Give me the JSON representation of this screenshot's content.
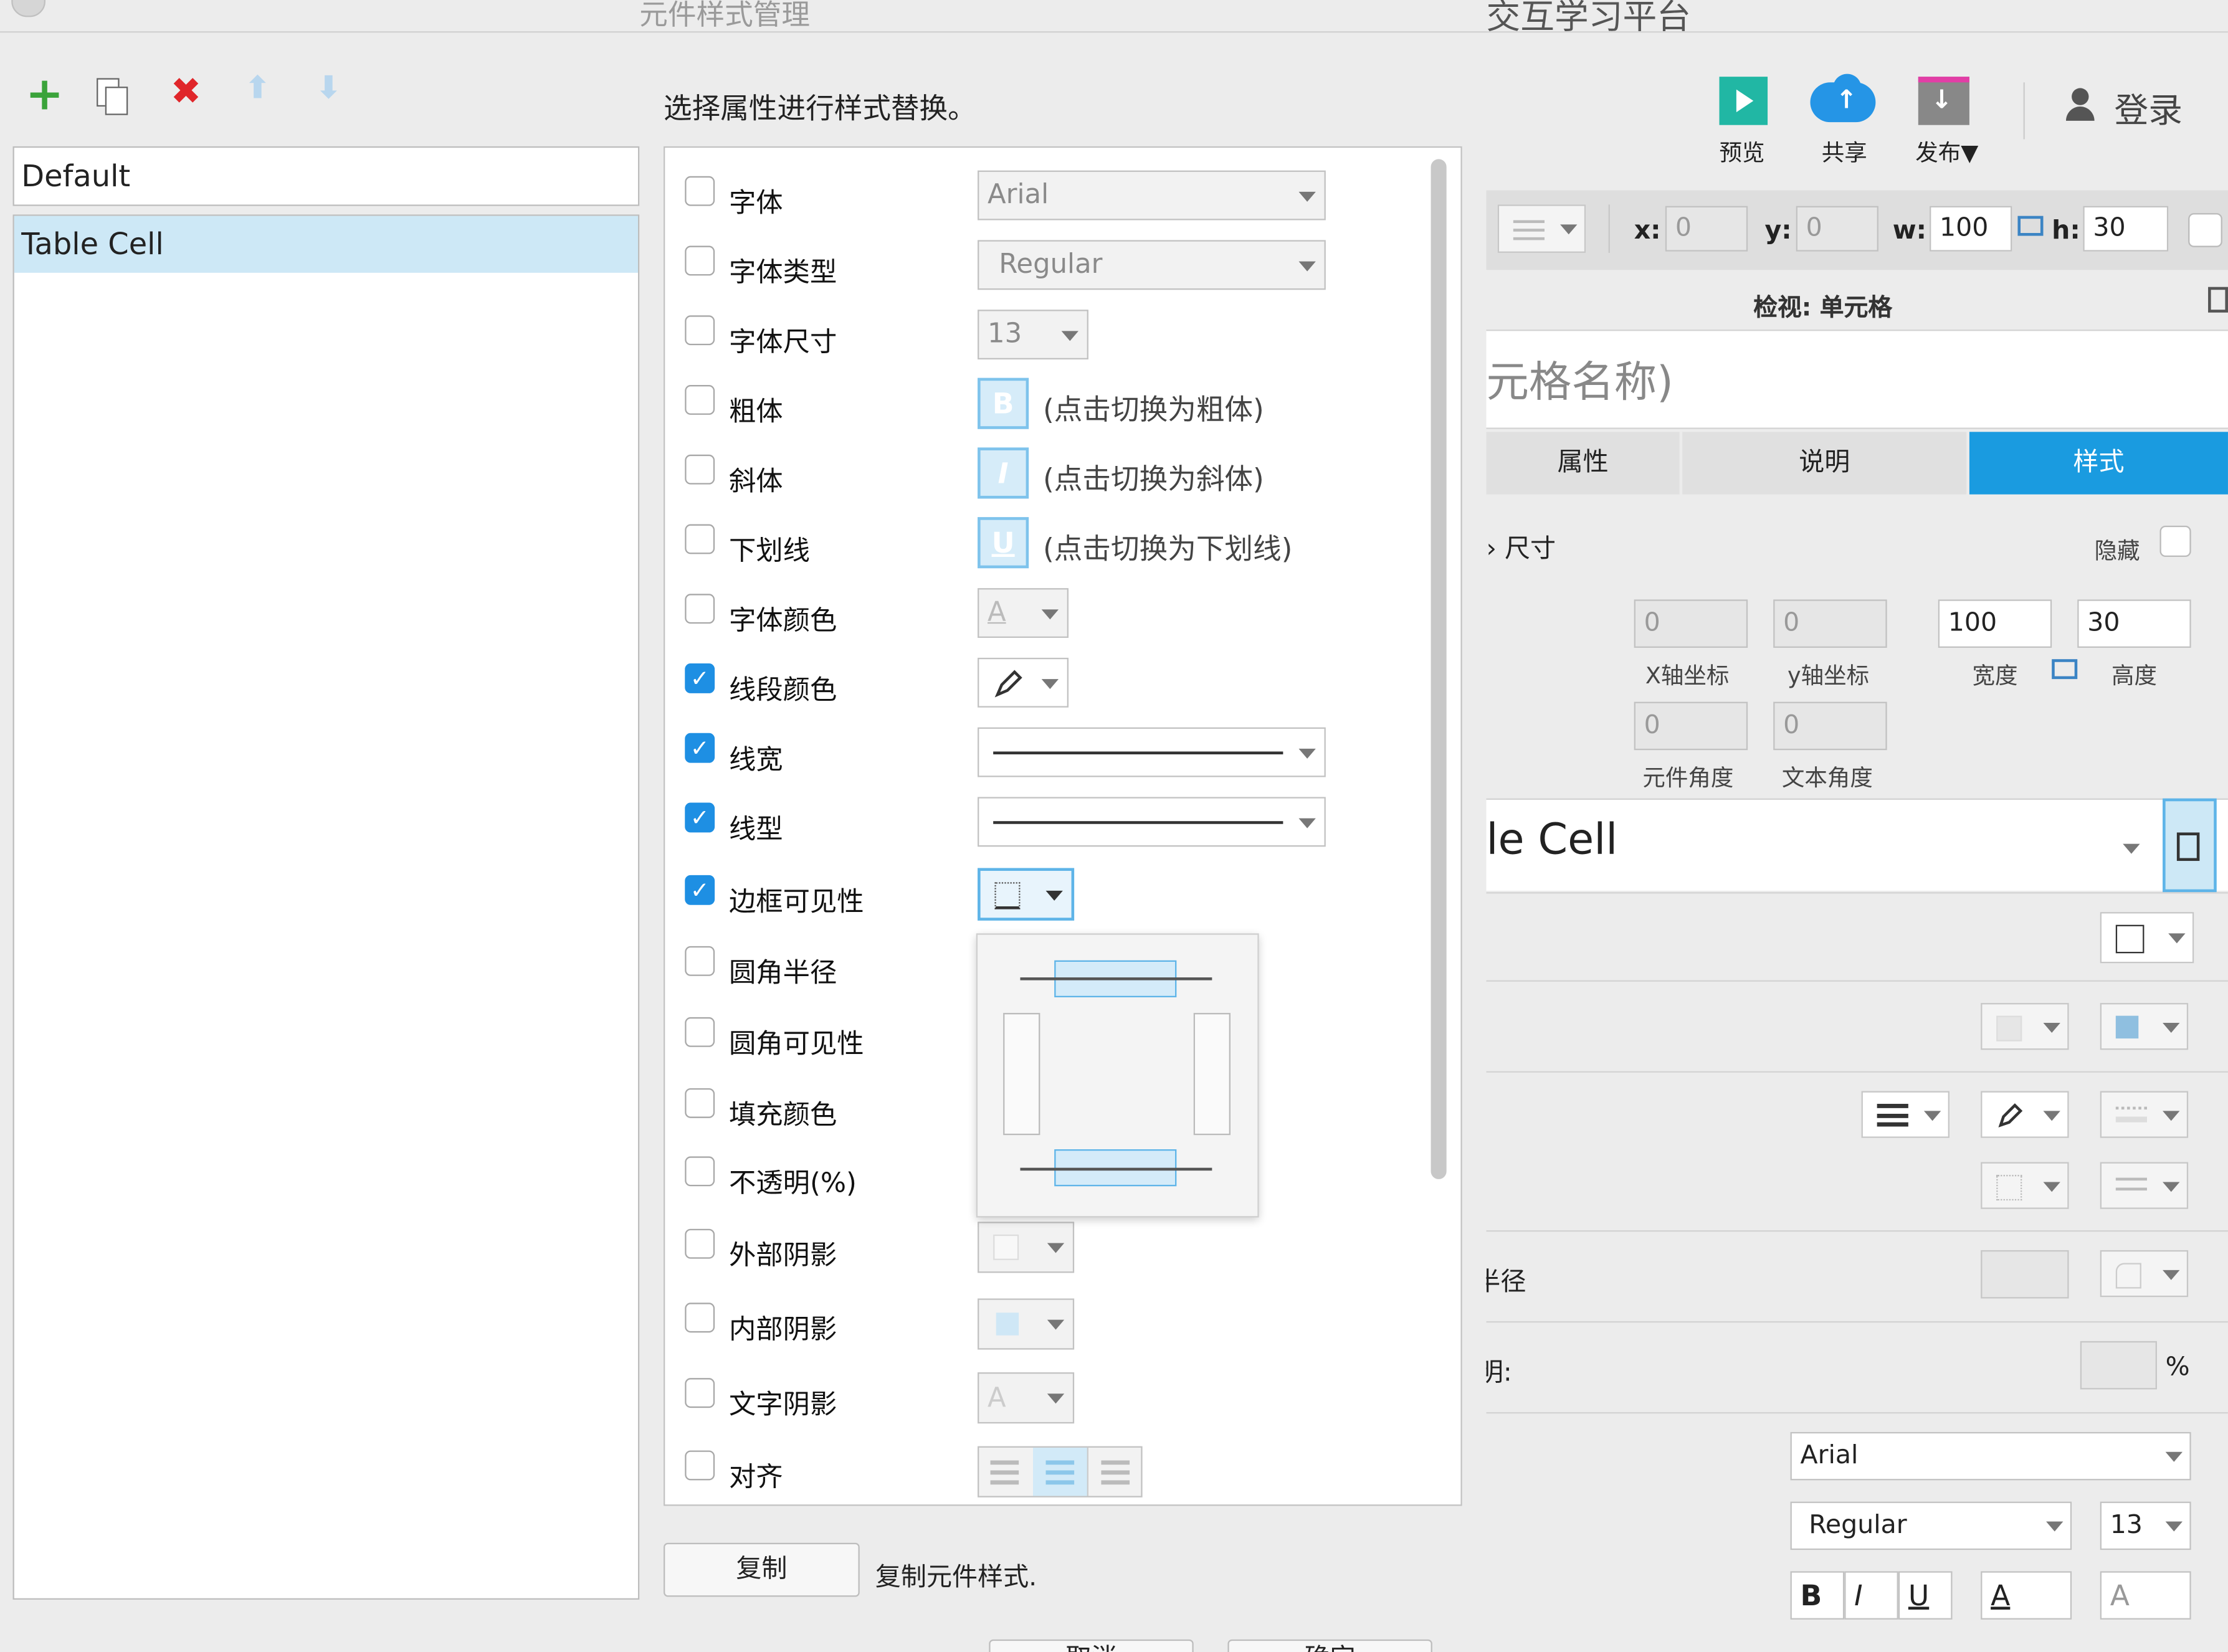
{
  "dialog": {
    "title": "元件样式管理",
    "toolbar": {
      "add": "+",
      "duplicate": "⎘",
      "delete": "✖",
      "up": "⬆",
      "down": "⬇"
    },
    "styles": [
      "Default",
      "Table Cell"
    ],
    "selected_style": "Table Cell",
    "instruction": "选择属性进行样式替换。",
    "properties": [
      {
        "label": "字体",
        "checked": false
      },
      {
        "label": "字体类型",
        "checked": false
      },
      {
        "label": "字体尺寸",
        "checked": false
      },
      {
        "label": "粗体",
        "checked": false
      },
      {
        "label": "斜体",
        "checked": false
      },
      {
        "label": "下划线",
        "checked": false
      },
      {
        "label": "字体颜色",
        "checked": false
      },
      {
        "label": "线段颜色",
        "checked": true
      },
      {
        "label": "线宽",
        "checked": true
      },
      {
        "label": "线型",
        "checked": true
      },
      {
        "label": "边框可见性",
        "checked": true
      },
      {
        "label": "圆角半径",
        "checked": false
      },
      {
        "label": "圆角可见性",
        "checked": false
      },
      {
        "label": "填充颜色",
        "checked": false
      },
      {
        "label": "不透明(%)",
        "checked": false
      },
      {
        "label": "外部阴影",
        "checked": false
      },
      {
        "label": "内部阴影",
        "checked": false
      },
      {
        "label": "文字阴影",
        "checked": false
      },
      {
        "label": "对齐",
        "checked": false
      }
    ],
    "values": {
      "font": "Arial",
      "font_type": "Regular",
      "font_size": "13",
      "bold_button": "B",
      "bold_hint": "(点击切换为粗体)",
      "italic_button": "I",
      "italic_hint": "(点击切换为斜体)",
      "underline_button": "U",
      "underline_hint": "(点击切换为下划线)",
      "font_color_glyph": "A",
      "text_shadow_glyph": "A"
    },
    "copy_button": "复制",
    "copy_desc": "复制元件样式.",
    "bottom_buttons": [
      "取消",
      "确定"
    ]
  },
  "app": {
    "title": "交互学习平台",
    "toolbar": [
      {
        "label": "预览",
        "icon": "preview-icon",
        "color": "#21b7a4"
      },
      {
        "label": "共享",
        "icon": "cloud-upload-icon",
        "color": "#2595e6"
      },
      {
        "label": "发布▼",
        "icon": "publish-icon",
        "color": "#888888"
      }
    ],
    "login": "登录",
    "coords": {
      "x_label": "x:",
      "x": "0",
      "y_label": "y:",
      "y": "0",
      "w_label": "w:",
      "w": "100",
      "h_label": "h:",
      "h": "30"
    },
    "inspect_title": "检视: 单元格",
    "name_placeholder": "元格名称)",
    "tabs": [
      {
        "label": "属性",
        "active": false
      },
      {
        "label": "说明",
        "active": false
      },
      {
        "label": "样式",
        "active": true
      }
    ],
    "size_label": "尺寸",
    "hidden_label": "隐藏",
    "fields": {
      "x": "0",
      "x_caption": "X轴坐标",
      "y": "0",
      "y_caption": "y轴坐标",
      "width": "100",
      "width_caption": "宽度",
      "height": "30",
      "height_caption": "高度",
      "angle": "0",
      "angle_caption": "元件角度",
      "text_angle": "0",
      "text_angle_caption": "文本角度"
    },
    "style_name": "le Cell",
    "radius_label": "半径",
    "opacity_label": "明:",
    "percent": "%",
    "font": "Arial",
    "font_type": "Regular",
    "font_size": "13",
    "format_buttons": [
      "B",
      "I",
      "U",
      "A",
      "A"
    ],
    "accent_color": "#1a9be0"
  }
}
